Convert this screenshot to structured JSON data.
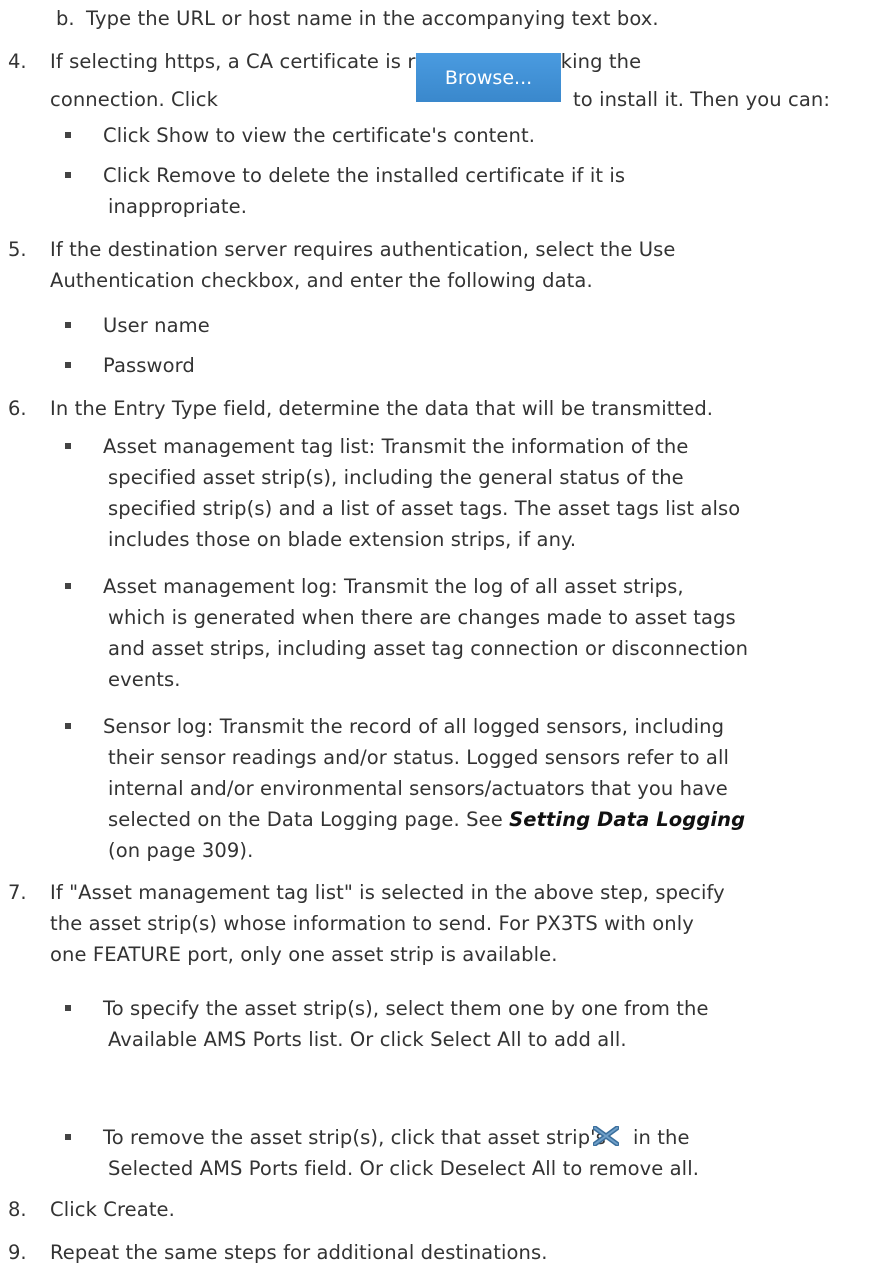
{
  "step3b": {
    "marker": "b.",
    "text": "Type the URL or host name in the accompanying text box."
  },
  "step4": {
    "number": "4.",
    "line1": "If selecting https, a CA certificate is required for making the",
    "line2_before": "connection. Click",
    "button_label": "Browse...",
    "line2_after": "to install it. Then you can:",
    "bullets": [
      [
        "Click Show to view the certificate's content."
      ],
      [
        "Click Remove to delete the installed certificate if it is",
        "inappropriate."
      ]
    ]
  },
  "step5": {
    "number": "5.",
    "lines": [
      "If the destination server requires authentication, select the Use",
      "Authentication checkbox, and enter the following data."
    ],
    "bullets": [
      [
        "User name"
      ],
      [
        "Password"
      ]
    ]
  },
  "step6": {
    "number": "6.",
    "line1": "In the Entry Type field, determine the data that will be transmitted.",
    "bullets": [
      [
        "Asset management tag list: Transmit the information of the",
        "specified asset strip(s), including the general status of the",
        "specified strip(s) and a list of asset tags. The asset tags list also",
        "includes those on blade extension strips, if any."
      ],
      [
        "Asset management log: Transmit the log of all asset strips,",
        "which is generated when there are changes made to asset tags",
        "and asset strips, including asset tag connection or disconnection",
        "events."
      ],
      [
        "Sensor log: Transmit the record of all logged sensors, including",
        "their sensor readings and/or status. Logged sensors refer to all",
        "internal and/or environmental sensors/actuators that you have"
      ]
    ],
    "sensor_line4_before": "selected on the Data Logging page. See",
    "sensor_link": "Setting Data Logging",
    "sensor_line5": "(on page 309)."
  },
  "step7": {
    "number": "7.",
    "lines": [
      "If \"Asset management tag list\" is selected in the above step, specify",
      "the asset strip(s) whose information to send. For PX3TS with only",
      "one FEATURE port, only one asset strip is available."
    ],
    "bullet1": [
      "To specify the asset strip(s), select them one by one from the",
      "Available AMS Ports list. Or click Select All to add all."
    ],
    "bullet2_before": "To remove the asset strip(s), click that asset strip's",
    "bullet2_icon": "x-icon",
    "bullet2_after": "in the",
    "bullet2_line2": "Selected AMS Ports field. Or click Deselect All to remove all."
  },
  "step8": {
    "number": "8.",
    "text": "Click Create."
  },
  "step9": {
    "number": "9.",
    "text": "Repeat the same steps for additional destinations."
  },
  "colors": {
    "text": "#333333",
    "button": "#3d8fd1",
    "x_icon": "#3a6e9c"
  }
}
